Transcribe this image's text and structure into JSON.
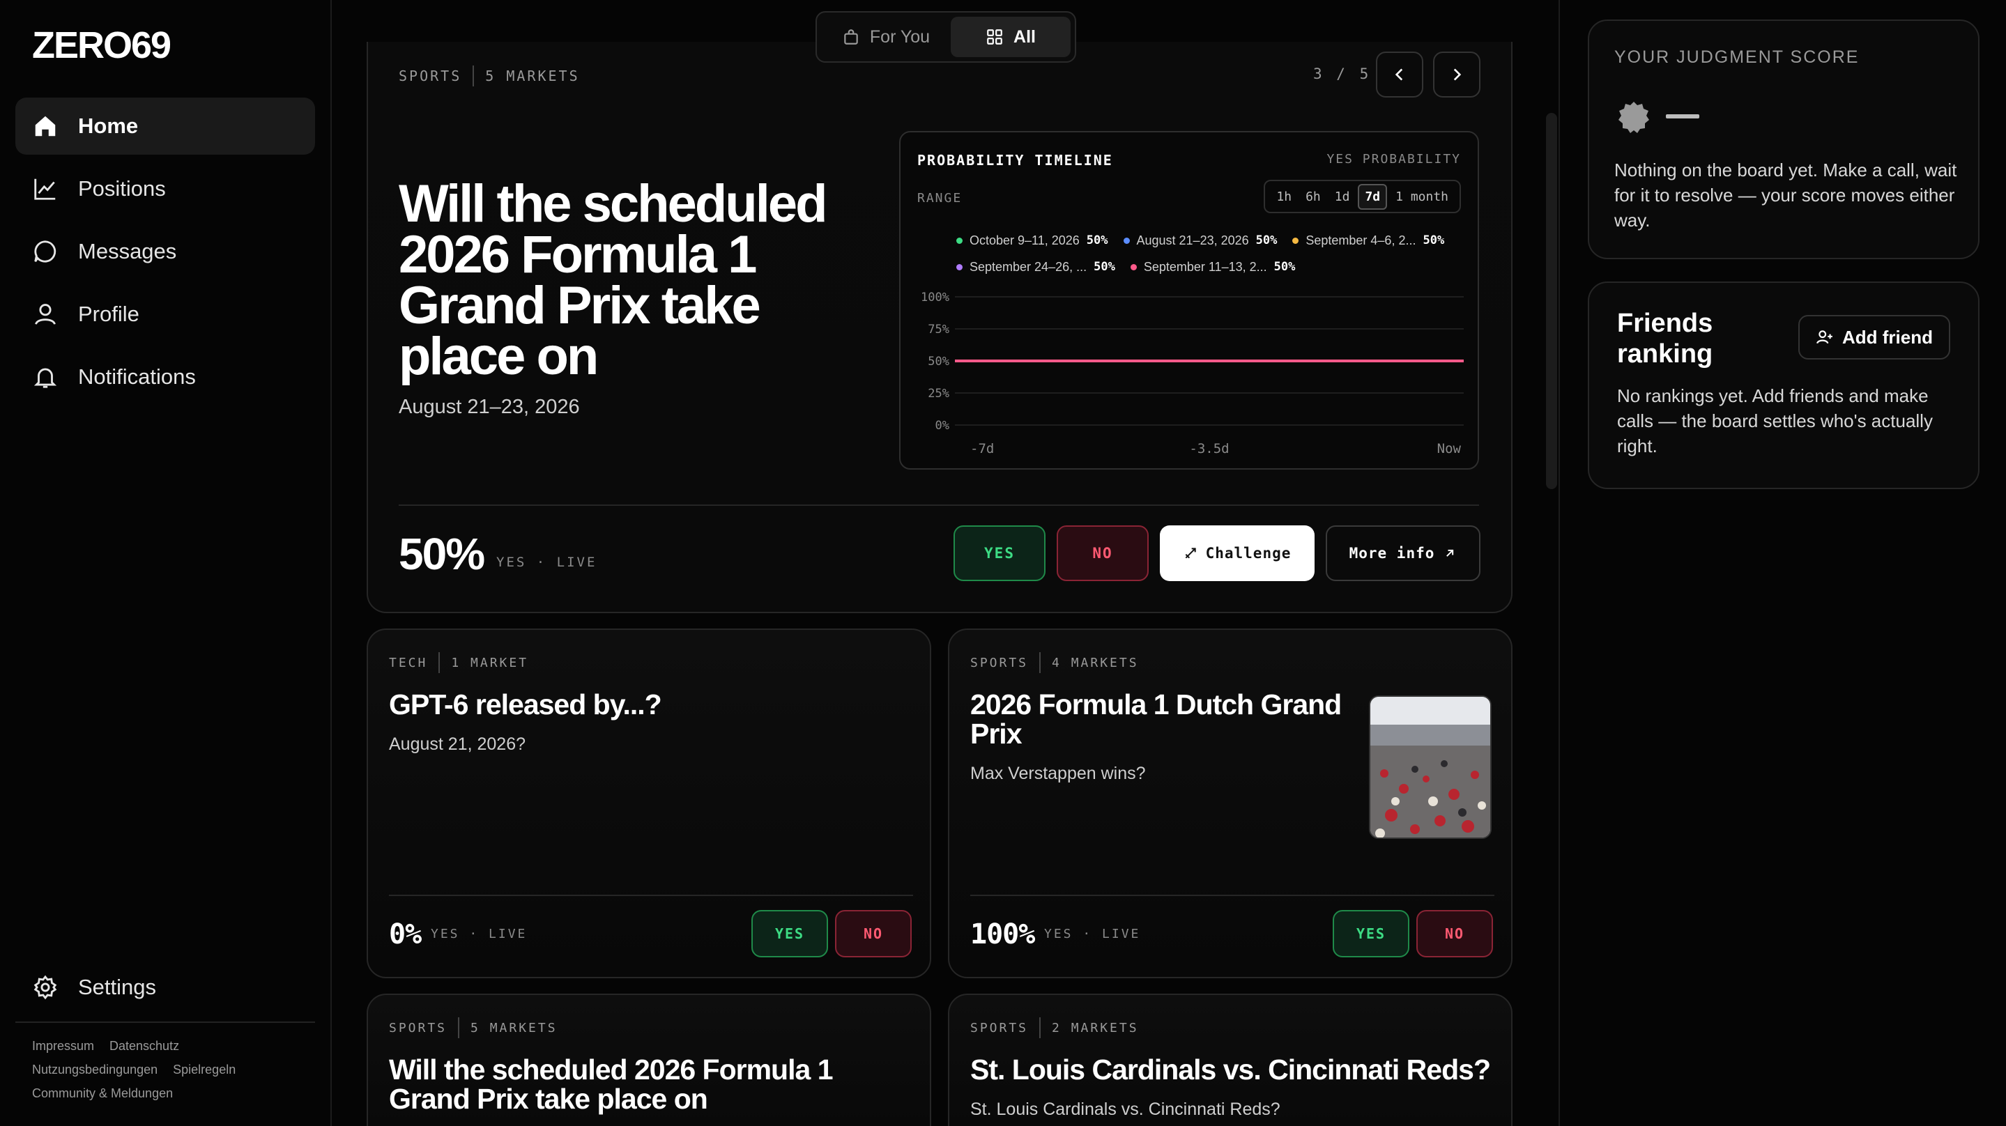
{
  "app": {
    "logo": "ZERO69"
  },
  "sidebar": {
    "items": [
      {
        "label": "Home",
        "icon": "home-icon",
        "active": true
      },
      {
        "label": "Positions",
        "icon": "chart-line-icon"
      },
      {
        "label": "Messages",
        "icon": "message-icon"
      },
      {
        "label": "Profile",
        "icon": "user-icon"
      },
      {
        "label": "Notifications",
        "icon": "bell-icon"
      }
    ],
    "settings": "Settings",
    "footer": [
      "Impressum",
      "Datenschutz",
      "Nutzungsbedingungen",
      "Spielregeln",
      "Community & Meldungen"
    ]
  },
  "toggle": {
    "for_you": "For You",
    "all": "All",
    "selected": "All"
  },
  "hero": {
    "category": "SPORTS",
    "markets": "5 MARKETS",
    "pager": "3 / 5",
    "title": "Will the scheduled 2026 Formula 1 Grand Prix take place on",
    "subtitle": "August 21–23, 2026",
    "percent": "50%",
    "live": "YES · LIVE",
    "yes": "YES",
    "no": "NO",
    "challenge": "Challenge",
    "more_info": "More info",
    "chart": {
      "title": "PROBABILITY TIMELINE",
      "yes_label": "YES PROBABILITY",
      "range_label": "RANGE",
      "ranges": [
        "1h",
        "6h",
        "1d",
        "7d",
        "1 month"
      ],
      "selected_range": "7d",
      "legend": [
        {
          "label": "October 9–11, 2026",
          "value": "50%",
          "color": "#3ddc84"
        },
        {
          "label": "August 21–23, 2026",
          "value": "50%",
          "color": "#5b8dff"
        },
        {
          "label": "September 4–6, 2...",
          "value": "50%",
          "color": "#f5b942"
        },
        {
          "label": "September 24–26, ...",
          "value": "50%",
          "color": "#b07cff"
        },
        {
          "label": "September 11–13, 2...",
          "value": "50%",
          "color": "#ff5a8a"
        }
      ]
    }
  },
  "chart_data": {
    "type": "line",
    "title": "PROBABILITY TIMELINE",
    "ylabel": "YES PROBABILITY",
    "x": [
      "-7d",
      "-3.5d",
      "Now"
    ],
    "yticks": [
      "100%",
      "75%",
      "50%",
      "25%",
      "0%"
    ],
    "ylim": [
      0,
      100
    ],
    "series": [
      {
        "name": "October 9–11, 2026",
        "values": [
          50,
          50,
          50
        ]
      },
      {
        "name": "August 21–23, 2026",
        "values": [
          50,
          50,
          50
        ]
      },
      {
        "name": "September 4–6, 2...",
        "values": [
          50,
          50,
          50
        ]
      },
      {
        "name": "September 24–26, ...",
        "values": [
          50,
          50,
          50
        ]
      },
      {
        "name": "September 11–13, 2...",
        "values": [
          50,
          50,
          50
        ]
      }
    ]
  },
  "cards": [
    {
      "category": "TECH",
      "markets": "1 MARKET",
      "title": "GPT-6 released by...?",
      "subtitle": "August 21, 2026?",
      "percent": "0%",
      "live": "YES · LIVE",
      "yes": "YES",
      "no": "NO"
    },
    {
      "category": "SPORTS",
      "markets": "4 MARKETS",
      "title": "2026 Formula 1 Dutch Grand Prix",
      "subtitle": "Max Verstappen wins?",
      "percent": "100%",
      "live": "YES · LIVE",
      "yes": "YES",
      "no": "NO"
    },
    {
      "category": "SPORTS",
      "markets": "5 MARKETS",
      "title": "Will the scheduled 2026 Formula 1 Grand Prix take place on"
    },
    {
      "category": "SPORTS",
      "markets": "2 MARKETS",
      "title": "St. Louis Cardinals vs. Cincinnati Reds?",
      "subtitle": "St. Louis Cardinals vs. Cincinnati Reds?"
    }
  ],
  "right": {
    "judgment_title": "YOUR JUDGMENT SCORE",
    "judgment_text": "Nothing on the board yet. Make a call, wait for it to resolve — your score moves either way.",
    "friends_title": "Friends ranking",
    "add_friend": "Add friend",
    "friends_text": "No rankings yet. Add friends and make calls — the board settles who's actually right."
  }
}
